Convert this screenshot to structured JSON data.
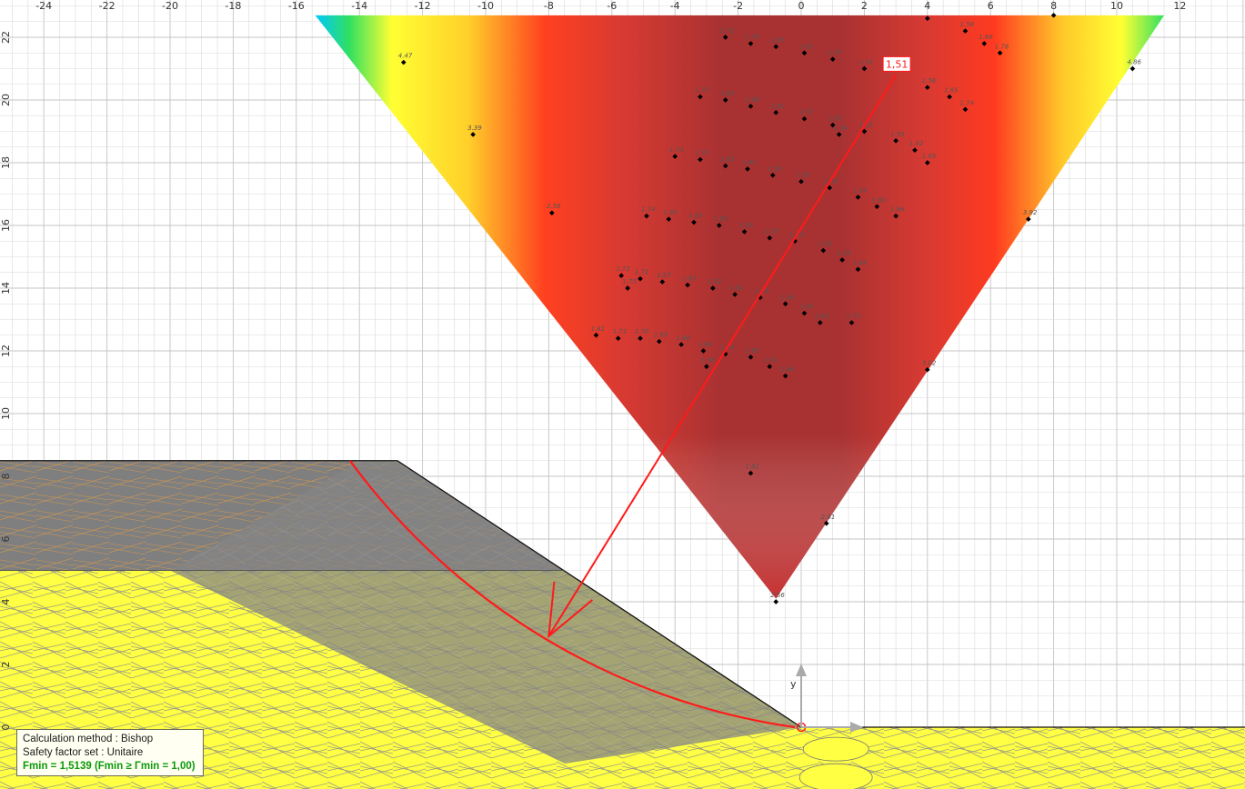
{
  "view": {
    "x_range": [
      -25.5,
      14.0
    ],
    "y_range": [
      -2.0,
      23.0
    ],
    "x_ticks": [
      -24,
      -22,
      -20,
      -18,
      -16,
      -14,
      -12,
      -10,
      -8,
      -6,
      -4,
      -2,
      0,
      2,
      4,
      6,
      8,
      10,
      12
    ],
    "y_ticks": [
      0,
      2,
      4,
      6,
      8,
      10,
      12,
      14,
      16,
      18,
      20,
      22
    ],
    "x_tick_labels": [
      "-24",
      "-22",
      "-20",
      "-18",
      "-16",
      "-14",
      "-12",
      "-10",
      "-8",
      "-6",
      "-4",
      "-2",
      "0",
      "2",
      "4",
      "6",
      "8",
      "10",
      "12"
    ],
    "y_tick_labels": [
      "0",
      "2",
      "4",
      "6",
      "8",
      "10",
      "12",
      "14",
      "16",
      "18",
      "20",
      "22"
    ],
    "grid": true
  },
  "slope_geometry": {
    "crest_level": 8.5,
    "crest_toe_x": -12.8,
    "toe_x": 0,
    "toe_y": 0,
    "layer_interface_y": 5.0
  },
  "critical_surface": {
    "center": [
      3.0,
      20.8
    ],
    "entry": [
      -14.3,
      8.5
    ],
    "exit": [
      -0.2,
      0
    ],
    "arrow_point": [
      -8.0,
      2.9
    ],
    "safety_factor_label": "1,51"
  },
  "axis_marker": {
    "label": "y"
  },
  "grid_points": [
    {
      "x": -12.6,
      "y": 21.2,
      "f": "4.47"
    },
    {
      "x": -10.4,
      "y": 18.9,
      "f": "3.39"
    },
    {
      "x": -7.9,
      "y": 16.4,
      "f": "2.56"
    },
    {
      "x": 4.0,
      "y": 22.6,
      "f": ""
    },
    {
      "x": 5.2,
      "y": 22.2,
      "f": "1.58"
    },
    {
      "x": 5.8,
      "y": 21.8,
      "f": "1.66"
    },
    {
      "x": 6.3,
      "y": 21.5,
      "f": "1.78"
    },
    {
      "x": 8.0,
      "y": 22.7,
      "f": ""
    },
    {
      "x": 10.5,
      "y": 21.0,
      "f": "4.86"
    },
    {
      "x": 7.2,
      "y": 16.2,
      "f": "3.92"
    },
    {
      "x": 4.0,
      "y": 11.4,
      "f": "3.02"
    },
    {
      "x": 0.8,
      "y": 6.5,
      "f": "2.61"
    },
    {
      "x": -0.8,
      "y": 4.0,
      "f": "2.56"
    },
    {
      "x": -1.6,
      "y": 8.1,
      "f": "1.81"
    },
    {
      "x": -2.4,
      "y": 22.0,
      "f": "1.72"
    },
    {
      "x": -1.6,
      "y": 21.8,
      "f": "1.70"
    },
    {
      "x": -0.8,
      "y": 21.7,
      "f": "1.65"
    },
    {
      "x": 0.1,
      "y": 21.5,
      "f": "1.62"
    },
    {
      "x": 1.0,
      "y": 21.3,
      "f": "1.57"
    },
    {
      "x": 2.0,
      "y": 21.0,
      "f": "1.54"
    },
    {
      "x": 4.0,
      "y": 20.4,
      "f": "1.56"
    },
    {
      "x": 4.7,
      "y": 20.1,
      "f": "1.65"
    },
    {
      "x": 5.2,
      "y": 19.7,
      "f": "1.74"
    },
    {
      "x": -3.2,
      "y": 20.1,
      "f": "1.75"
    },
    {
      "x": -2.4,
      "y": 20.0,
      "f": "1.69"
    },
    {
      "x": -1.6,
      "y": 19.8,
      "f": "1.66"
    },
    {
      "x": -0.8,
      "y": 19.6,
      "f": "1.61"
    },
    {
      "x": 0.1,
      "y": 19.4,
      "f": "1.57"
    },
    {
      "x": 1.0,
      "y": 19.2,
      "f": "1.55"
    },
    {
      "x": 1.2,
      "y": 18.9,
      "f": "1.54"
    },
    {
      "x": 2.0,
      "y": 19.0,
      "f": "1.52"
    },
    {
      "x": 3.0,
      "y": 18.7,
      "f": "1.55"
    },
    {
      "x": 3.6,
      "y": 18.4,
      "f": "1.62"
    },
    {
      "x": 4.0,
      "y": 18.0,
      "f": "1.69"
    },
    {
      "x": -4.0,
      "y": 18.2,
      "f": "1.74"
    },
    {
      "x": -3.2,
      "y": 18.1,
      "f": "1.70"
    },
    {
      "x": -2.4,
      "y": 17.9,
      "f": "1.65"
    },
    {
      "x": -1.7,
      "y": 17.8,
      "f": "1.61"
    },
    {
      "x": -0.9,
      "y": 17.6,
      "f": "1.59"
    },
    {
      "x": 0.0,
      "y": 17.4,
      "f": "1.55"
    },
    {
      "x": 0.9,
      "y": 17.2,
      "f": "1.53"
    },
    {
      "x": 1.8,
      "y": 16.9,
      "f": "1.54"
    },
    {
      "x": 2.4,
      "y": 16.6,
      "f": "1.60"
    },
    {
      "x": 3.0,
      "y": 16.3,
      "f": "1.66"
    },
    {
      "x": -4.9,
      "y": 16.3,
      "f": "1.74"
    },
    {
      "x": -4.2,
      "y": 16.2,
      "f": "1.69"
    },
    {
      "x": -3.4,
      "y": 16.1,
      "f": "1.65"
    },
    {
      "x": -2.6,
      "y": 16.0,
      "f": "1.63"
    },
    {
      "x": -1.8,
      "y": 15.8,
      "f": "1.59"
    },
    {
      "x": -1.0,
      "y": 15.6,
      "f": "1.57"
    },
    {
      "x": -0.2,
      "y": 15.5,
      "f": "1.54"
    },
    {
      "x": 0.7,
      "y": 15.2,
      "f": "1.55"
    },
    {
      "x": 1.3,
      "y": 14.9,
      "f": "1.59"
    },
    {
      "x": 1.8,
      "y": 14.6,
      "f": "1.64"
    },
    {
      "x": -5.7,
      "y": 14.4,
      "f": "1.72"
    },
    {
      "x": -5.5,
      "y": 14.0,
      "f": "1.75"
    },
    {
      "x": -5.1,
      "y": 14.3,
      "f": "1.71"
    },
    {
      "x": -4.4,
      "y": 14.2,
      "f": "1.67"
    },
    {
      "x": -3.6,
      "y": 14.1,
      "f": "1.63"
    },
    {
      "x": -2.8,
      "y": 14.0,
      "f": "1.62"
    },
    {
      "x": -2.1,
      "y": 13.8,
      "f": "1.61"
    },
    {
      "x": -1.3,
      "y": 13.7,
      "f": "1.59"
    },
    {
      "x": -0.5,
      "y": 13.5,
      "f": "1.58"
    },
    {
      "x": 0.1,
      "y": 13.2,
      "f": "1.60"
    },
    {
      "x": 0.6,
      "y": 12.9,
      "f": "1.63"
    },
    {
      "x": 1.6,
      "y": 12.9,
      "f": "1.73"
    },
    {
      "x": -6.5,
      "y": 12.5,
      "f": "1.81"
    },
    {
      "x": -5.8,
      "y": 12.4,
      "f": "1.71"
    },
    {
      "x": -5.1,
      "y": 12.4,
      "f": "1.70"
    },
    {
      "x": -4.5,
      "y": 12.3,
      "f": "1.69"
    },
    {
      "x": -3.8,
      "y": 12.2,
      "f": "1.68"
    },
    {
      "x": -3.1,
      "y": 12.0,
      "f": "1.66"
    },
    {
      "x": -2.4,
      "y": 11.9,
      "f": "1.64"
    },
    {
      "x": -1.6,
      "y": 11.8,
      "f": "1.65"
    },
    {
      "x": -1.0,
      "y": 11.5,
      "f": "1.61"
    },
    {
      "x": -0.5,
      "y": 11.2,
      "f": "1.66"
    },
    {
      "x": -3.0,
      "y": 11.5,
      "f": "1.66"
    }
  ],
  "info": {
    "method": "Calculation method : Bishop",
    "factor_set": "Safety factor set : Unitaire",
    "fmin": "Fmin = 1,5139 (Fmin ≥ Γmin = 1,00)"
  },
  "colors": {
    "grid": "#d9d9d9",
    "grid_major": "#c4c4c4",
    "soil_upper": "#7f7f7f",
    "soil_trace_upper": "#f2a03a",
    "soil_lower": "#ffff44",
    "critical": "#ff1a1a",
    "min_region": "#a83232"
  }
}
